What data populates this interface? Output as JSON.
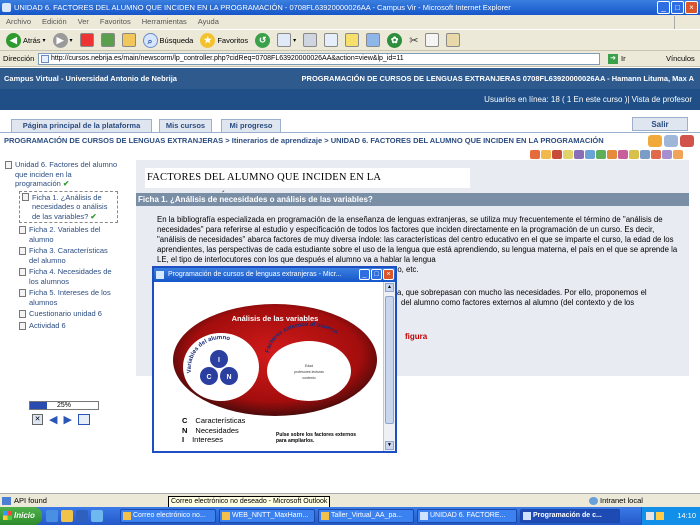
{
  "window": {
    "title": "UNIDAD 6. FACTORES DEL ALUMNO QUE INCIDEN EN LA PROGRAMACIÓN - 0708FL63920000026AA - Campus Vir - Microsoft Internet Explorer"
  },
  "menu": [
    "Archivo",
    "Edición",
    "Ver",
    "Favoritos",
    "Herramientas",
    "Ayuda"
  ],
  "toolbar": {
    "back": "Atrás",
    "search": "Búsqueda",
    "favorites": "Favoritos"
  },
  "address": {
    "label": "Dirección",
    "url": "http://cursos.nebrija.es/main/newscorm/lp_controller.php?cidReq=0708FL63920000026AA&action=view&lp_id=11",
    "go": "Ir",
    "links": "Vínculos"
  },
  "campus": {
    "left": "Campus Virtual - Universidad Antonio de Nebrija",
    "right": "PROGRAMACIÓN DE CURSOS DE LENGUAS EXTRANJERAS 0708FL63920000026AA - Hamann Lituma, Max A",
    "online": "Usuarios en línea:  18  ( 1 En este curso  )| Vista de profesor"
  },
  "nav": {
    "tabs": [
      "Página principal de la plataforma",
      "Mis cursos",
      "Mi progreso"
    ],
    "logout": "Salir"
  },
  "breadcrumb": "PROGRAMACIÓN DE CURSOS DE LENGUAS EXTRANJERAS > Itinerarios de aprendizaje > UNIDAD 6. FACTORES DEL ALUMNO QUE INCIDEN EN LA PROGRAMACIÓN",
  "toc": {
    "unit": "Unidad 6. Factores del alumno que inciden en la programación",
    "active": "Ficha 1. ¿Análisis de necesidades o análisis de las variables?",
    "items": [
      "Ficha 2. Variables del alumno",
      "Ficha 3. Características del alumno",
      "Ficha 4. Necesidades de los alumnos",
      "Ficha 5. Intereses de los alumnos",
      "Cuestionario unidad 6",
      "Actividad 6"
    ],
    "check": "✔"
  },
  "progress": {
    "percent": 25,
    "label": "25%"
  },
  "content": {
    "chapter_title": "FACTORES DEL ALUMNO QUE INCIDEN EN LA PROGRAMACIÓN",
    "section_title": "Ficha 1. ¿Análisis de necesidades o análisis de las variables?",
    "paragraph": "En la bibliografía especializada en programación de la enseñanza de lenguas extranjeras, se utiliza muy frecuentemente el término de \"análisis de necesidades\" para referirse al estudio y especificación de todos los factores que inciden directamente en la programación de un curso. Es decir, \"análisis de necesidades\" abarca factores de muy diversa índole: las características del centro educativo en el que se imparte el curso, la edad de los aprendientes, las perspectivas de cada estudiante sobre el uso de la lengua que está aprendiendo, su lengua materna, el país en el que se aprende la LE, el tipo de interlocutores con los que después el alumno va a hablar la lengua",
    "paragraph_end": "no, etc.",
    "paragraph2_a": "a, que sobrepasan con mucho las necesidades. Por ello, proponemos el",
    "paragraph2_b": "del alumno como factores externos al alumno (del contexto y de los",
    "figure_link": "figura"
  },
  "popup": {
    "title": "Programación de cursos de lenguas extranjeras - Micr...",
    "figure": {
      "title": "Análisis de las variables",
      "inner_arc": "Variables del alumno",
      "outer_arc": "Factores externos al alumno",
      "circle_letters": [
        "I",
        "C",
        "N"
      ],
      "small_lines": [
        "Edad",
        "profesores  lecturas",
        "contexto"
      ]
    },
    "legend": [
      {
        "key": "C",
        "label": "Características"
      },
      {
        "key": "N",
        "label": "Necesidades"
      },
      {
        "key": "I",
        "label": "Intereses"
      }
    ],
    "note": "Pulse sobre los factores externos para ampliarlos."
  },
  "status": {
    "left": "API found",
    "zone": "Intranet local",
    "tooltip": "Correo electrónico no deseado - Microsoft Outlook"
  },
  "taskbar": {
    "start": "Inicio",
    "tasks": [
      "Correo electrónico no...",
      "WEB_NNTT_MaxHam...",
      "Taller_Virtual_AA_pa...",
      "UNIDAD 6. FACTORE...",
      "Programación de c..."
    ],
    "clock": "14:10"
  },
  "colors": {
    "campus_header": "#2e5a8e",
    "section_bar": "#7a8ea6",
    "figure_red": "#c00000",
    "link_blue": "#2b4c80"
  }
}
